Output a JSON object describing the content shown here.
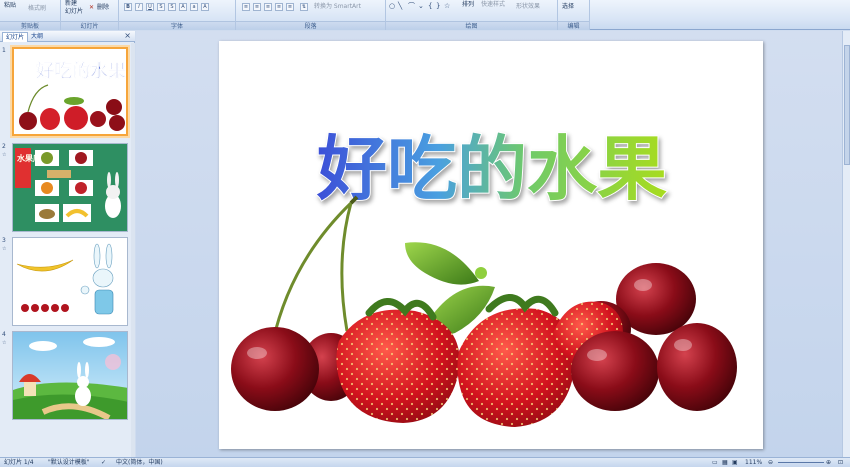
{
  "ribbon": {
    "clipboard": {
      "paste": "粘贴",
      "format_painter": "格式刷",
      "label": "剪贴板"
    },
    "slides": {
      "new_slide": "新建\n幻灯片",
      "delete": "删除",
      "label": "幻灯片"
    },
    "font": {
      "label": "字体"
    },
    "paragraph": {
      "smartart": "转换为 SmartArt",
      "label": "段落"
    },
    "drawing": {
      "arrange": "排列",
      "quick_styles": "快速样式",
      "shape_effects": "形状效果",
      "label": "绘图"
    },
    "editing": {
      "select": "选择",
      "label": "编辑"
    }
  },
  "left_panel": {
    "tab_slides": "幻灯片",
    "tab_outline": "大纲",
    "close": "×",
    "thumbnails": [
      {
        "number": "1",
        "title": "好吃的水果"
      },
      {
        "number": "2",
        "title": "水果店"
      },
      {
        "number": "3",
        "title": ""
      },
      {
        "number": "4",
        "title": ""
      }
    ]
  },
  "slide": {
    "title": "好吃的水果"
  },
  "status_bar": {
    "slide_info": "幻灯片 1/4",
    "theme": "\"默认设计模板\"",
    "language": "中文(简体，中国)",
    "zoom": "111%"
  },
  "colors": {
    "ribbon_bg": "#dfe9f6",
    "selection": "#f6a53a",
    "title_blue": "#3c5ed8",
    "title_green": "#9ad62a"
  }
}
